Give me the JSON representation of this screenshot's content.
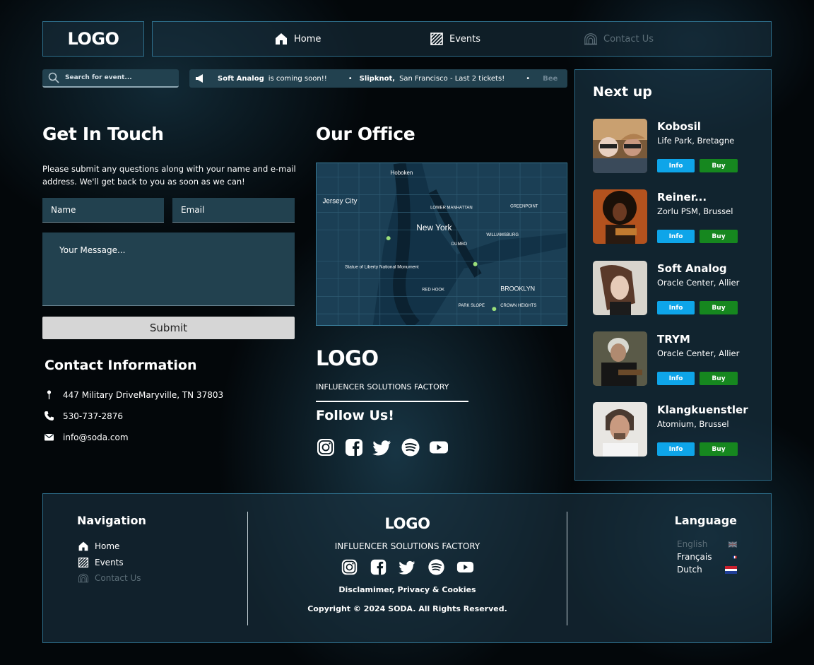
{
  "header": {
    "logo": "LOGO",
    "nav": [
      {
        "label": "Home",
        "icon": "home-icon"
      },
      {
        "label": "Events",
        "icon": "events-icon"
      },
      {
        "label": "Contact Us",
        "icon": "contact-icon"
      }
    ]
  },
  "search": {
    "placeholder": "Search for event..."
  },
  "ticker": {
    "items": [
      {
        "name": "Soft Analog",
        "text": "is coming soon!!"
      },
      {
        "name": "Slipknot,",
        "text": "San Francisco - Last 2 tickets!"
      }
    ],
    "trailing": "Bee"
  },
  "contact": {
    "title": "Get In Touch",
    "intro": "Please submit any questions along with your name and e-mail address. We'll get back to you as soon as we can!",
    "name_placeholder": "Name",
    "email_placeholder": "Email",
    "message_placeholder": "Your Message...",
    "submit_label": "Submit",
    "info_title": "Contact Information",
    "address": "447 Military DriveMaryville, TN 37803",
    "phone": "530-737-2876",
    "email": "info@soda.com"
  },
  "office": {
    "title": "Our Office",
    "logo": "LOGO",
    "tagline": "INFLUENCER SOLUTIONS FACTORY",
    "follow_title": "Follow Us!",
    "map_labels": {
      "hoboken": "Hoboken",
      "jersey_city": "Jersey City",
      "new_york": "New York",
      "brooklyn": "BROOKLYN",
      "statue": "Statue of Liberty National Monument",
      "lower_manhattan": "LOWER MANHATTAN",
      "williamsburg": "WILLIAMSBURG",
      "greenpoint": "GREENPOINT",
      "dumbo": "DUMBO",
      "park_slope": "PARK SLOPE",
      "red_hook": "RED HOOK",
      "crown_heights": "CROWN HEIGHTS"
    }
  },
  "nextup": {
    "title": "Next up",
    "info_label": "Info",
    "buy_label": "Buy",
    "events": [
      {
        "name": "Kobosil",
        "venue": "Life Park, Bretagne"
      },
      {
        "name": "Reiner...",
        "venue": "Zorlu PSM, Brussel"
      },
      {
        "name": "Soft Analog",
        "venue": "Oracle Center, Allier"
      },
      {
        "name": "TRYM",
        "venue": "Oracle Center, Allier"
      },
      {
        "name": "Klangkuenstler",
        "venue": "Atomium, Brussel"
      }
    ]
  },
  "footer": {
    "nav_title": "Navigation",
    "nav": [
      "Home",
      "Events",
      "Contact Us"
    ],
    "logo": "LOGO",
    "tagline": "INFLUENCER SOLUTIONS FACTORY",
    "legal": "Disclamimer, Privacy & Cookies",
    "copyright": "Copyright © 2024 SODA. All Rights Reserved.",
    "lang_title": "Language",
    "languages": [
      "English",
      "Français",
      "Dutch"
    ]
  },
  "colors": {
    "accent": "#0ea5e9",
    "buy": "#16871f",
    "panel_border": "#2e6f8c",
    "inactive": "#5b6d77"
  }
}
